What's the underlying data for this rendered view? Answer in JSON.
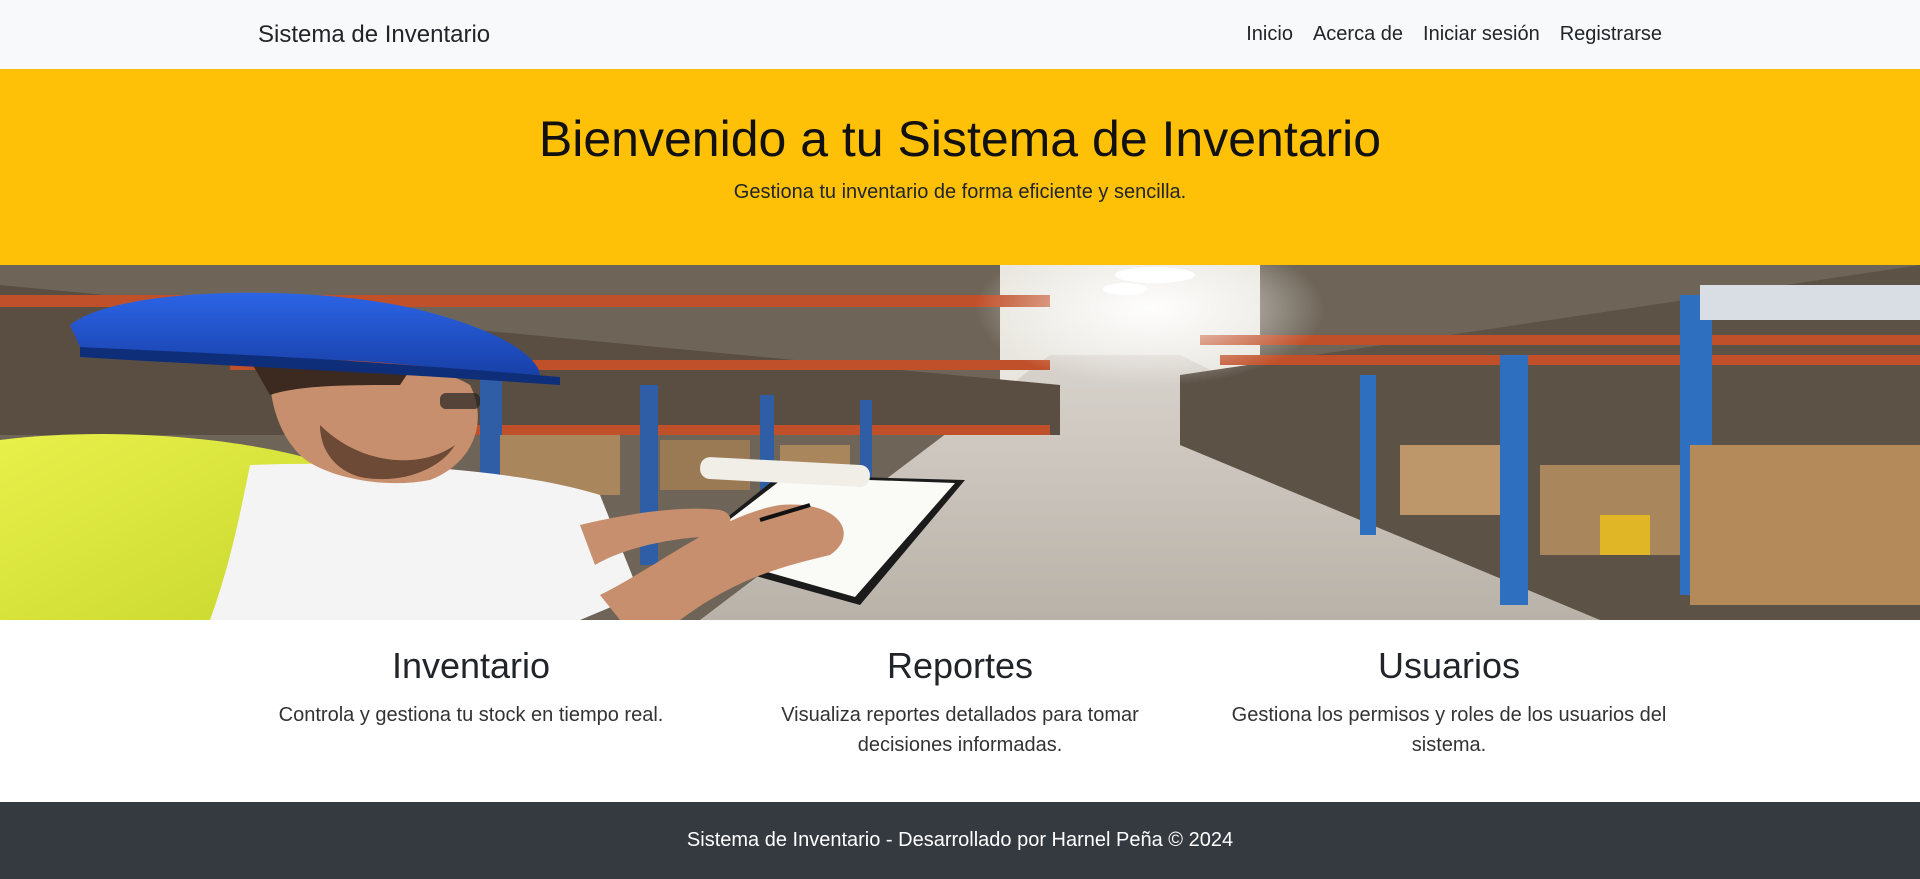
{
  "navbar": {
    "brand": "Sistema de Inventario",
    "links": [
      "Inicio",
      "Acerca de",
      "Iniciar sesión",
      "Registrarse"
    ]
  },
  "hero": {
    "title": "Bienvenido a tu Sistema de Inventario",
    "subtitle": "Gestiona tu inventario de forma eficiente y sencilla.",
    "background": "#ffc107"
  },
  "banner": {
    "image": "warehouse-worker-clipboard-photo"
  },
  "features": [
    {
      "title": "Inventario",
      "text": "Controla y gestiona tu stock en tiempo real."
    },
    {
      "title": "Reportes",
      "text": "Visualiza reportes detallados para tomar decisiones informadas."
    },
    {
      "title": "Usuarios",
      "text": "Gestiona los permisos y roles de los usuarios del sistema."
    }
  ],
  "footer": {
    "text": "Sistema de Inventario - Desarrollado por Harnel Peña © 2024",
    "background": "#343a40"
  }
}
